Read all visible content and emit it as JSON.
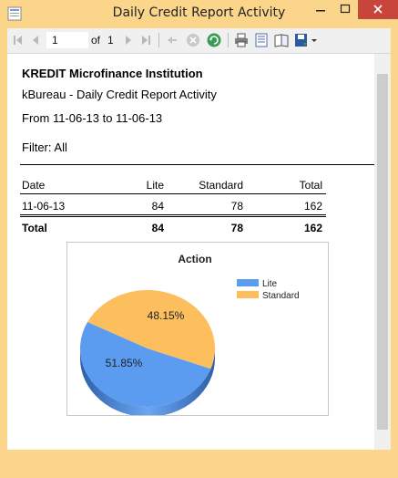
{
  "window": {
    "title": "Daily Credit Report Activity"
  },
  "toolbar": {
    "current_page": "1",
    "of_label": "of",
    "total_pages": "1"
  },
  "report": {
    "org_name": "KREDIT Microfinance Institution",
    "subtitle": "kBureau - Daily Credit Report Activity",
    "date_range": "From 11-06-13 to 11-06-13",
    "filter": "Filter: All",
    "table": {
      "headers": [
        "Date",
        "Lite",
        "Standard",
        "Total"
      ],
      "rows": [
        {
          "date": "11-06-13",
          "lite": "84",
          "standard": "78",
          "total": "162"
        }
      ],
      "totals": {
        "label": "Total",
        "lite": "84",
        "standard": "78",
        "total": "162"
      }
    }
  },
  "chart_data": {
    "type": "pie",
    "title": "Action",
    "labels": [
      "Lite",
      "Standard"
    ],
    "values": [
      51.85,
      48.15
    ],
    "value_labels": [
      "51.85%",
      "48.15%"
    ],
    "colors": [
      "#5b9cf0",
      "#fdbf5e"
    ],
    "legend_placement": "top-right"
  },
  "colors": {
    "titlebar": "#fbd68a",
    "close_button": "#c7453b",
    "lite": "#5b9cf0",
    "standard": "#fdbf5e"
  }
}
